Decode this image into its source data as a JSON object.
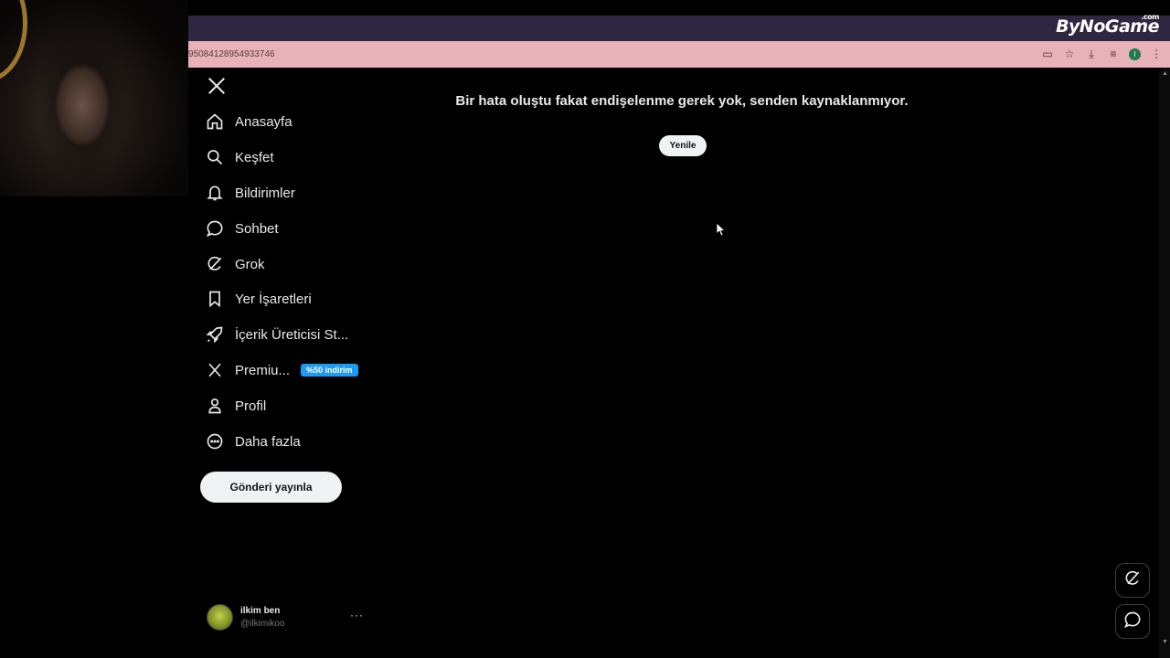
{
  "browser": {
    "url": "95084128954933746",
    "brand": "ByNoGame",
    "brand_suffix": ".com"
  },
  "sidebar": {
    "items": [
      {
        "label": "Anasayfa",
        "icon": "home-icon"
      },
      {
        "label": "Keşfet",
        "icon": "search-icon"
      },
      {
        "label": "Bildirimler",
        "icon": "bell-icon"
      },
      {
        "label": "Sohbet",
        "icon": "chat-bubble-icon"
      },
      {
        "label": "Grok",
        "icon": "grok-icon"
      },
      {
        "label": "Yer İşaretleri",
        "icon": "bookmark-icon"
      },
      {
        "label": "İçerik Üreticisi St...",
        "icon": "rocket-icon"
      },
      {
        "label": "Premiu...",
        "icon": "x-logo-icon",
        "badge": "%50 indirim"
      },
      {
        "label": "Profil",
        "icon": "person-icon"
      },
      {
        "label": "Daha fazla",
        "icon": "more-circle-icon"
      }
    ],
    "post_button": "Gönderi yayınla"
  },
  "account": {
    "name": "ilkim ben",
    "handle": "@ilkimikoo",
    "more": "···"
  },
  "main": {
    "error_message": "Bir hata oluştu fakat endişelenme gerek yok, senden kaynaklanmıyor.",
    "retry_label": "Yenile"
  },
  "colors": {
    "accent": "#1d9bf0",
    "background": "#000000",
    "address_bar": "#e8b2b9",
    "tab_strip": "#2d2640"
  }
}
